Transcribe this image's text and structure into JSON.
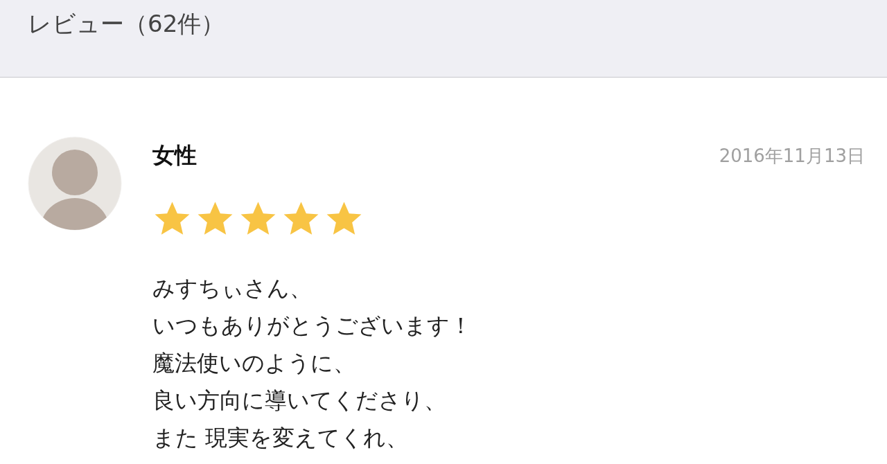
{
  "header": {
    "title": "レビュー（62件）"
  },
  "review": {
    "author": "女性",
    "date": "2016年11月13日",
    "stars": 5,
    "lines": [
      "みすちぃさん、",
      "いつもありがとうございます！",
      "魔法使いのように、",
      "良い方向に導いてくださり、",
      "また 現実を変えてくれ、"
    ]
  }
}
